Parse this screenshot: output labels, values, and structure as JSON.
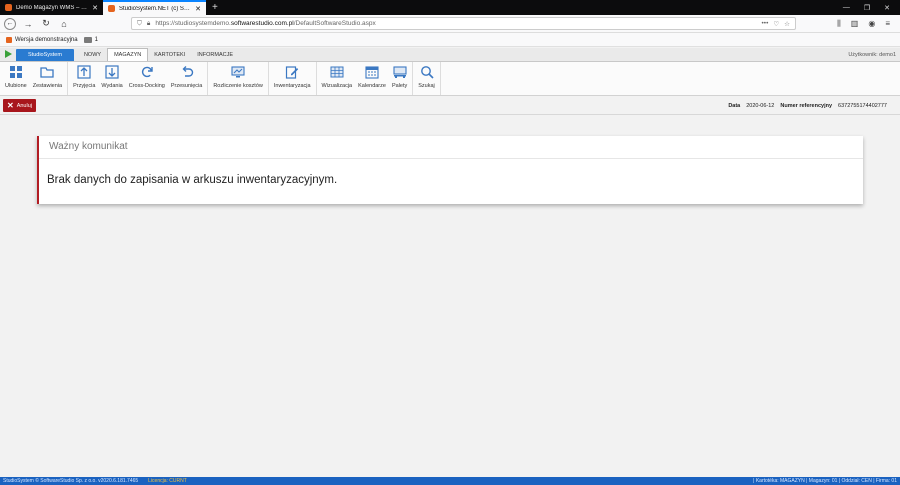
{
  "browser": {
    "tabs": [
      {
        "title": "Demo Magazyn WMS – Demo",
        "active": false
      },
      {
        "title": "StudioSystem.NET (c) Software",
        "active": true
      }
    ],
    "url_prefix": "https://studiosystemdemo.",
    "url_host": "softwarestudio.com.pl",
    "url_path": "/DefaultSoftwareStudio.aspx",
    "bookmarks": [
      {
        "label": "Wersja demonstracyjna"
      },
      {
        "label": "1"
      }
    ]
  },
  "app": {
    "app_button": "StudioSystem",
    "menu_tabs": [
      "NOWY",
      "MAGAZYN",
      "KARTOTEKI",
      "INFORMACJE"
    ],
    "active_menu_tab": "MAGAZYN",
    "user_label": "Użytkownik: demo1"
  },
  "ribbon": {
    "buttons": [
      {
        "label": "Ulubione",
        "icon": "grid-favorites-icon"
      },
      {
        "label": "Zestawienia",
        "icon": "folder-icon"
      },
      {
        "label": "Przyjęcia",
        "icon": "arrow-up-box-icon"
      },
      {
        "label": "Wydania",
        "icon": "arrow-down-box-icon"
      },
      {
        "label": "Cross-Docking",
        "icon": "refresh-icon"
      },
      {
        "label": "Przesunięcia",
        "icon": "undo-arrow-icon"
      },
      {
        "label": "Rozliczenie kosztów",
        "icon": "monitor-chart-icon"
      },
      {
        "label": "Inwentaryzacja",
        "icon": "edit-document-icon"
      },
      {
        "label": "Wizualizacja",
        "icon": "warehouse-grid-icon"
      },
      {
        "label": "Kalendarze",
        "icon": "calendar-icon"
      },
      {
        "label": "Palety",
        "icon": "pallet-icon"
      },
      {
        "label": "Szukaj",
        "icon": "search-icon"
      }
    ]
  },
  "actionbar": {
    "cancel_label": "Anuluj",
    "date_label": "Data",
    "date_value": "2020-06-12",
    "ref_label": "Numer referencyjny",
    "ref_value": "6372755174402777"
  },
  "dialog": {
    "title": "Ważny komunikat",
    "message": "Brak danych do zapisania w arkuszu inwentaryzacyjnym."
  },
  "statusbar": {
    "left": "StudioSystem © SoftwareStudio Sp. z o.o. v2020.6.181.7465",
    "license": "Licencja: CURNT",
    "right": "| Kartotéka: MAGAZYN | Magazyn: 01 | Oddział: CEN | Firma: 01"
  },
  "colors": {
    "accent_blue": "#2a7bd1",
    "cancel_red": "#a8161c",
    "status_blue": "#1a62c0"
  }
}
